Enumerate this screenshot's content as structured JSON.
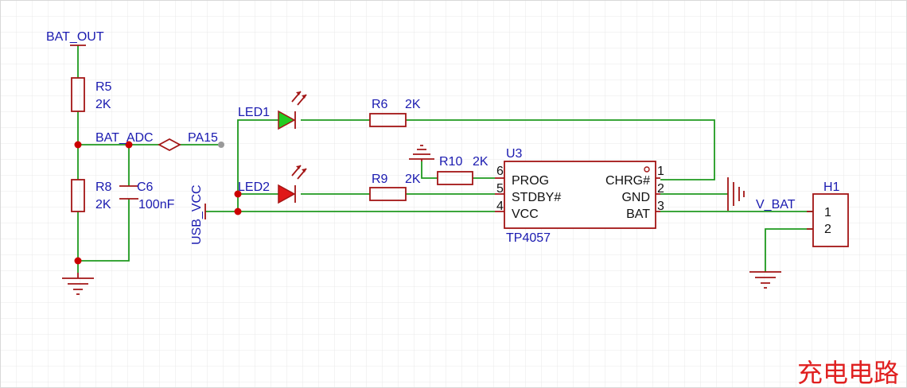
{
  "net_labels": {
    "bat_out": "BAT_OUT",
    "bat_adc": "BAT_ADC",
    "pa15": "PA15",
    "usb_vcc": "USB_VCC",
    "v_bat": "V_BAT"
  },
  "components": {
    "r5": {
      "ref": "R5",
      "value": "2K"
    },
    "r8": {
      "ref": "R8",
      "value": "2K"
    },
    "c6": {
      "ref": "C6",
      "value": "100nF"
    },
    "led1": {
      "ref": "LED1",
      "color": "#22cc22"
    },
    "led2": {
      "ref": "LED2",
      "color": "#e01818"
    },
    "r6": {
      "ref": "R6",
      "value": "2K"
    },
    "r9": {
      "ref": "R9",
      "value": "2K"
    },
    "r10": {
      "ref": "R10",
      "value": "2K"
    },
    "h1": {
      "ref": "H1",
      "pin1": "1",
      "pin2": "2"
    }
  },
  "ic": {
    "ref": "U3",
    "part": "TP4057",
    "pins_left": [
      {
        "num": "6",
        "name": "PROG"
      },
      {
        "num": "5",
        "name": "STDBY#"
      },
      {
        "num": "4",
        "name": "VCC"
      }
    ],
    "pins_right": [
      {
        "num": "1",
        "name": "CHRG#"
      },
      {
        "num": "2",
        "name": "GND"
      },
      {
        "num": "3",
        "name": "BAT"
      }
    ]
  },
  "title": "充电电路",
  "colors": {
    "wire": "#1f9a1f",
    "component": "#a31515",
    "net_label": "#1a1ab0",
    "junction": "#cc0000",
    "title": "#e02020"
  }
}
